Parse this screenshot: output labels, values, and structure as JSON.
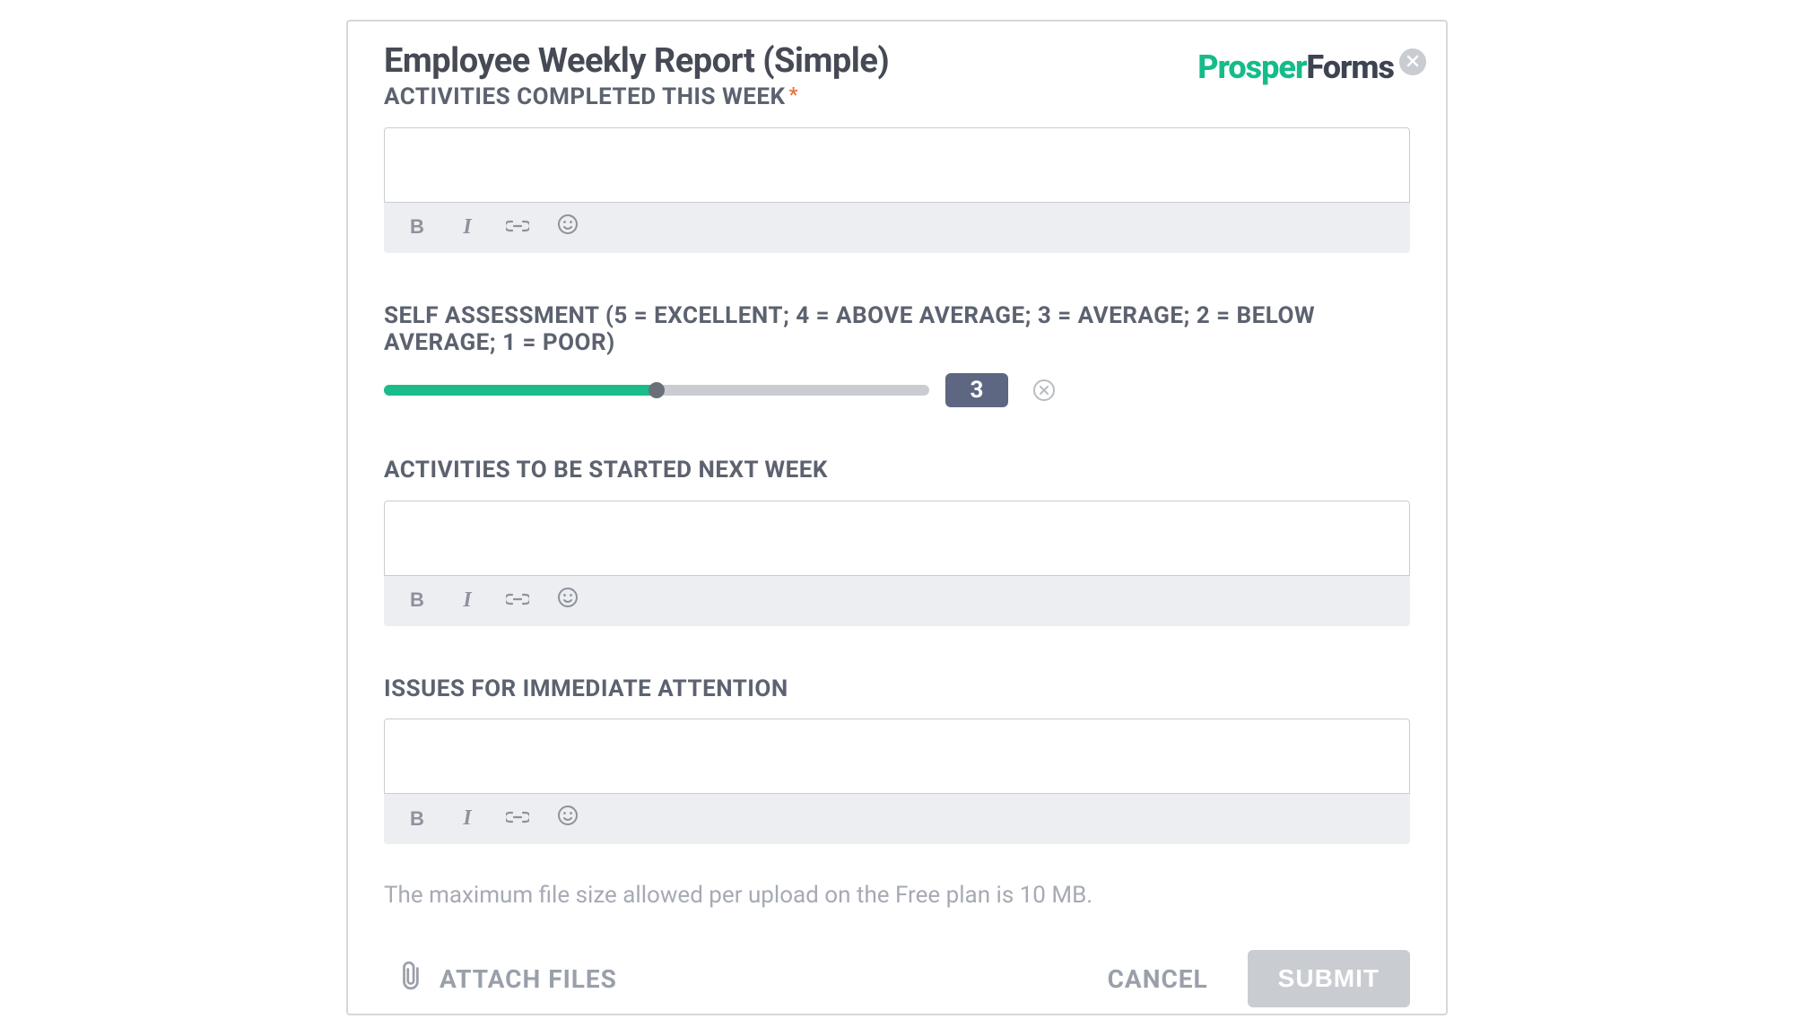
{
  "header": {
    "title": "Employee Weekly Report (Simple)",
    "logo_part1": "Prosper",
    "logo_part2": "Forms"
  },
  "fields": {
    "activities_completed": {
      "label": "ACTIVITIES COMPLETED THIS WEEK",
      "required": true,
      "value": ""
    },
    "self_assessment": {
      "label": "SELF ASSESSMENT (5 = EXCELLENT; 4 = ABOVE AVERAGE; 3 = AVERAGE; 2 = BELOW AVERAGE; 1 = POOR)",
      "value": 3,
      "min": 1,
      "max": 5,
      "fill_percent": 50
    },
    "activities_next": {
      "label": "ACTIVITIES TO BE STARTED NEXT WEEK",
      "value": ""
    },
    "issues": {
      "label": "ISSUES FOR IMMEDIATE ATTENTION",
      "value": ""
    }
  },
  "toolbar": {
    "bold": "B",
    "italic": "I"
  },
  "upload": {
    "note": "The maximum file size allowed per upload on the Free plan is 10 MB.",
    "attach_label": "ATTACH FILES"
  },
  "actions": {
    "cancel": "CANCEL",
    "submit": "SUBMIT"
  },
  "icons": {
    "close": "close-icon",
    "bold": "bold-icon",
    "italic": "italic-icon",
    "link": "link-icon",
    "emoji": "emoji-icon",
    "clear": "clear-circle-icon",
    "paperclip": "paperclip-icon"
  },
  "colors": {
    "accent_green": "#1abc8a",
    "badge_blue": "#5d6782",
    "text_dark": "#454a55",
    "muted": "#9aa0aa",
    "required": "#e8743b"
  }
}
